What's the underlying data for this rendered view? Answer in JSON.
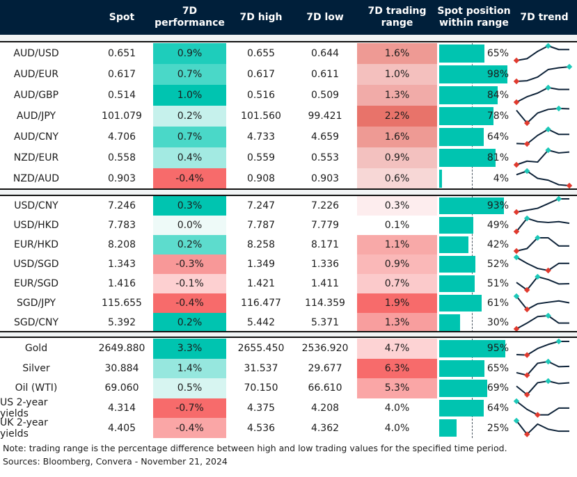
{
  "header": {
    "columns": [
      "",
      "Spot",
      "7D\nperformance",
      "7D high",
      "7D low",
      "7D trading\nrange",
      "Spot position\nwithin range",
      "7D trend"
    ]
  },
  "colors": {
    "header_bg": "#001F3A",
    "bar": "#00C4B0",
    "trend_line": "#0D2238",
    "trend_max": "#1CC8B8",
    "trend_min": "#E03A2E"
  },
  "groups": [
    {
      "rows": [
        {
          "label": "AUD/USD",
          "spot": "0.651",
          "perf": "0.9%",
          "perf_color": "#1ECDBB",
          "high": "0.655",
          "low": "0.644",
          "range": "1.6%",
          "range_color": "#EE9A94",
          "position_pct": 65,
          "position": "65%",
          "trend": [
            2,
            3,
            7,
            10,
            8,
            8
          ],
          "trend_max": 3,
          "trend_min": 0
        },
        {
          "label": "AUD/EUR",
          "spot": "0.617",
          "perf": "0.7%",
          "perf_color": "#4AD8C8",
          "high": "0.617",
          "low": "0.611",
          "range": "1.0%",
          "range_color": "#F4C0BE",
          "position_pct": 98,
          "position": "98%",
          "trend": [
            1,
            1.3,
            3,
            6.5,
            7.3,
            7.8
          ],
          "trend_max": 5,
          "trend_min": 0
        },
        {
          "label": "AUD/GBP",
          "spot": "0.514",
          "perf": "1.0%",
          "perf_color": "#00C4B0",
          "high": "0.516",
          "low": "0.509",
          "range": "1.3%",
          "range_color": "#F1ABA8",
          "position_pct": 84,
          "position": "84%",
          "trend": [
            0,
            3,
            5,
            8,
            7,
            7
          ],
          "trend_max": 3,
          "trend_min": 0
        },
        {
          "label": "AUD/JPY",
          "spot": "101.079",
          "perf": "0.2%",
          "perf_color": "#C6F1EC",
          "high": "101.560",
          "low": "99.421",
          "range": "2.2%",
          "range_color": "#E8736A",
          "position_pct": 78,
          "position": "78%",
          "trend": [
            7,
            0,
            5.5,
            7.5,
            8,
            7.8
          ],
          "trend_max": 4,
          "trend_min": 1
        },
        {
          "label": "AUD/CNY",
          "spot": "4.706",
          "perf": "0.7%",
          "perf_color": "#4AD8C8",
          "high": "4.733",
          "low": "4.659",
          "range": "1.6%",
          "range_color": "#EE9A94",
          "position_pct": 64,
          "position": "64%",
          "trend": [
            1,
            0.8,
            5,
            8,
            5.5,
            5.5
          ],
          "trend_max": 3,
          "trend_min": 1
        },
        {
          "label": "NZD/EUR",
          "spot": "0.558",
          "perf": "0.4%",
          "perf_color": "#A3EAE2",
          "high": "0.559",
          "low": "0.553",
          "range": "0.9%",
          "range_color": "#F3C1BF",
          "position_pct": 81,
          "position": "81%",
          "trend": [
            0,
            2,
            1.5,
            8,
            6.5,
            7
          ],
          "trend_max": 3,
          "trend_min": 0
        },
        {
          "label": "NZD/AUD",
          "spot": "0.903",
          "perf": "-0.4%",
          "perf_color": "#F76B6B",
          "high": "0.908",
          "low": "0.903",
          "range": "0.6%",
          "range_color": "#F7D7D6",
          "position_pct": 4,
          "position": "4%",
          "trend": [
            6,
            8,
            4,
            3,
            0.5,
            0
          ],
          "trend_max": 1,
          "trend_min": 5
        }
      ]
    },
    {
      "rows": [
        {
          "label": "USD/CNY",
          "spot": "7.246",
          "perf": "0.3%",
          "perf_color": "#00C4B0",
          "high": "7.247",
          "low": "7.226",
          "range": "0.3%",
          "range_color": "#FDEDEE",
          "position_pct": 93,
          "position": "93%",
          "trend": [
            0,
            1,
            2,
            4.5,
            7,
            7
          ],
          "trend_max": 4,
          "trend_min": 0
        },
        {
          "label": "USD/HKD",
          "spot": "7.783",
          "perf": "0.0%",
          "perf_color": "#EEFAF8",
          "high": "7.787",
          "low": "7.779",
          "range": "0.1%",
          "range_color": "#FFFFFF",
          "position_pct": 49,
          "position": "49%",
          "trend": [
            0,
            8,
            6,
            5.5,
            6,
            5
          ],
          "trend_max": 1,
          "trend_min": 0
        },
        {
          "label": "EUR/HKD",
          "spot": "8.208",
          "perf": "0.2%",
          "perf_color": "#5DDCCD",
          "high": "8.258",
          "low": "8.171",
          "range": "1.1%",
          "range_color": "#F8A9A8",
          "position_pct": 42,
          "position": "42%",
          "trend": [
            0,
            1.2,
            6.5,
            6.5,
            2.5,
            2.5
          ],
          "trend_max": 2,
          "trend_min": 0
        },
        {
          "label": "USD/SGD",
          "spot": "1.343",
          "perf": "-0.3%",
          "perf_color": "#F89898",
          "high": "1.349",
          "low": "1.336",
          "range": "0.9%",
          "range_color": "#FAB8B8",
          "position_pct": 52,
          "position": "52%",
          "trend": [
            8,
            5,
            2.5,
            1.5,
            5,
            5
          ],
          "trend_max": 0,
          "trend_min": 3
        },
        {
          "label": "EUR/SGD",
          "spot": "1.416",
          "perf": "-0.1%",
          "perf_color": "#FDD0D1",
          "high": "1.421",
          "low": "1.411",
          "range": "0.7%",
          "range_color": "#FBCACB",
          "position_pct": 51,
          "position": "51%",
          "trend": [
            5,
            1,
            8,
            6.5,
            4.2,
            4.3
          ],
          "trend_max": 2,
          "trend_min": 1
        },
        {
          "label": "SGD/JPY",
          "spot": "115.655",
          "perf": "-0.4%",
          "perf_color": "#F76B6B",
          "high": "116.477",
          "low": "114.359",
          "range": "1.9%",
          "range_color": "#F76B6B",
          "position_pct": 61,
          "position": "61%",
          "trend": [
            8,
            1,
            4,
            4.8,
            5.5,
            4.5
          ],
          "trend_max": 0,
          "trend_min": 1
        },
        {
          "label": "SGD/CNY",
          "spot": "5.392",
          "perf": "0.2%",
          "perf_color": "#00C4B0",
          "high": "5.442",
          "low": "5.371",
          "range": "1.3%",
          "range_color": "#F89E9E",
          "position_pct": 30,
          "position": "30%",
          "trend": [
            0,
            3.2,
            6.8,
            7.3,
            3.2,
            3.2
          ],
          "trend_max": 3,
          "trend_min": 0
        }
      ]
    },
    {
      "rows": [
        {
          "label": "Gold",
          "spot": "2649.880",
          "perf": "3.3%",
          "perf_color": "#00C4B0",
          "high": "2655.450",
          "low": "2536.920",
          "range": "4.7%",
          "range_color": "#FDD3D4",
          "position_pct": 95,
          "position": "95%",
          "trend": [
            1.5,
            1.3,
            4.5,
            6.5,
            8,
            8
          ],
          "trend_max": 4,
          "trend_min": 1
        },
        {
          "label": "Silver",
          "spot": "30.884",
          "perf": "1.4%",
          "perf_color": "#96E7DE",
          "high": "31.537",
          "low": "29.677",
          "range": "6.3%",
          "range_color": "#F76B6B",
          "position_pct": 65,
          "position": "65%",
          "trend": [
            1.5,
            0,
            7,
            8,
            5,
            5.2
          ],
          "trend_max": 3,
          "trend_min": 1
        },
        {
          "label": "Oil (WTI)",
          "spot": "69.060",
          "perf": "0.5%",
          "perf_color": "#D7F5F1",
          "high": "70.150",
          "low": "66.610",
          "range": "5.3%",
          "range_color": "#FAA6A6",
          "position_pct": 69,
          "position": "69%",
          "trend": [
            5,
            0,
            7,
            8,
            6.5,
            7
          ],
          "trend_max": 3,
          "trend_min": 1
        },
        {
          "label": "US 2-year yields",
          "spot": "4.314",
          "perf": "-0.7%",
          "perf_color": "#F76B6B",
          "high": "4.375",
          "low": "4.208",
          "range": "4.0%",
          "range_color": "#FFFFFF",
          "position_pct": 64,
          "position": "64%",
          "trend": [
            8,
            3.5,
            0.5,
            0.5,
            4.2,
            4.2
          ],
          "trend_max": 0,
          "trend_min": 2
        },
        {
          "label": "UK 2-year yields",
          "spot": "4.405",
          "perf": "-0.4%",
          "perf_color": "#FAA6A6",
          "high": "4.536",
          "low": "4.362",
          "range": "4.0%",
          "range_color": "#FFFFFF",
          "position_pct": 25,
          "position": "25%",
          "trend": [
            8,
            0,
            6,
            3,
            1.8,
            1.8
          ],
          "trend_max": 0,
          "trend_min": 1
        }
      ]
    }
  ],
  "footer": {
    "note": "Note: trading range is the percentage difference between high and low trading values for the specified time period.",
    "sources": "Sources: Bloomberg, Convera - November 21, 2024"
  }
}
